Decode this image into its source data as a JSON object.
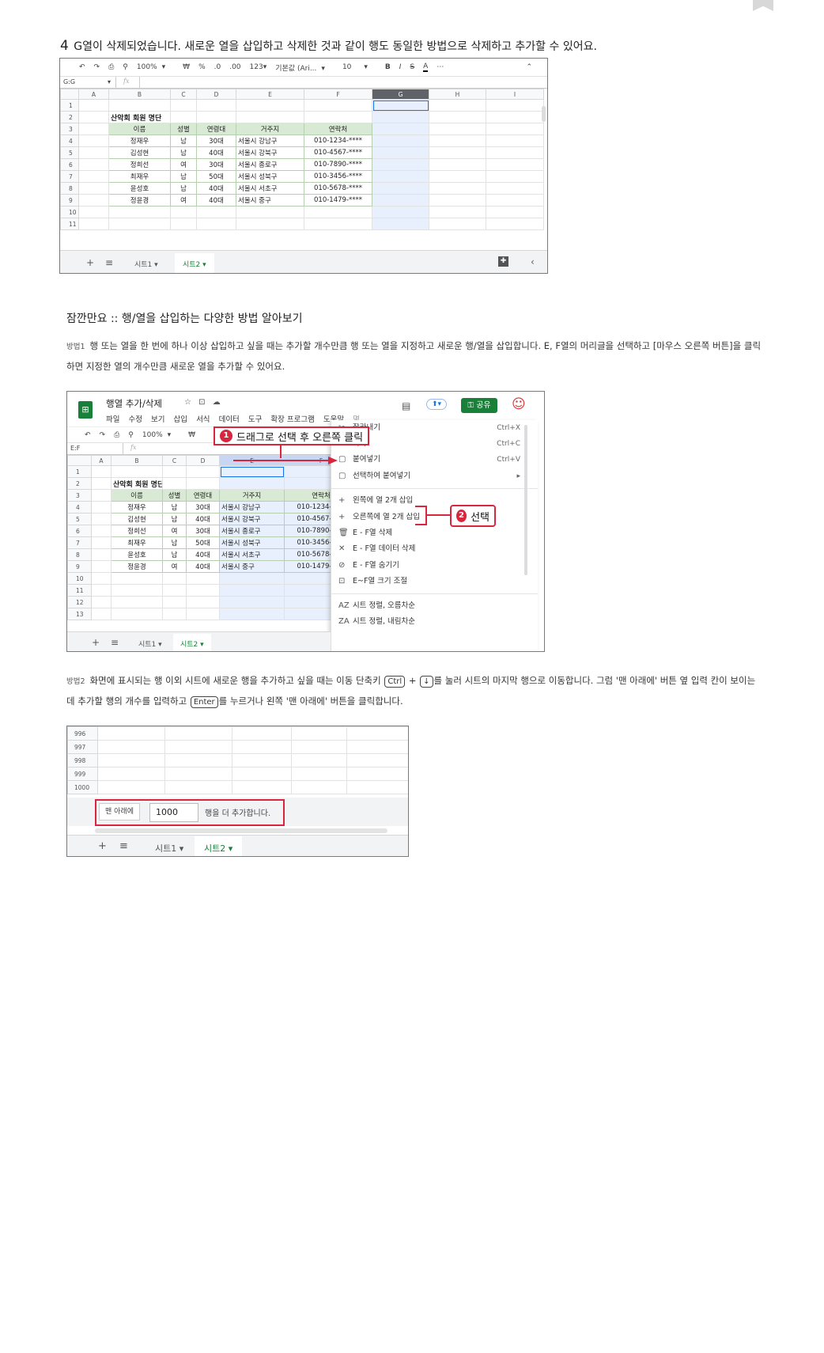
{
  "step4": {
    "number": "4",
    "text": "G열이 삭제되었습니다. 새로운 열을 삽입하고 삭제한 것과 같이 행도 동일한 방법으로 삭제하고 추가할 수 있어요."
  },
  "sheet1": {
    "toolbar": {
      "undo": "↶",
      "redo": "↷",
      "print": "⎙",
      "paint": "⚲",
      "zoom": "100%",
      "zoom_caret": "▾",
      "currency": "₩",
      "percent": "%",
      "dec_less": ".0",
      "dec_more": ".00",
      "format": "123▾",
      "font": "기본값 (Ari...",
      "font_caret": "▾",
      "size": "10",
      "size_caret": "▾",
      "bold": "B",
      "italic": "I",
      "strike": "S",
      "text_color": "A",
      "more": "⋯",
      "collapse": "⌃"
    },
    "namebox": "G:G",
    "namebox_caret": "▾",
    "fx": "fx",
    "columns": [
      "A",
      "B",
      "C",
      "D",
      "E",
      "F",
      "G",
      "H",
      "I"
    ],
    "row_numbers": [
      "1",
      "2",
      "3",
      "4",
      "5",
      "6",
      "7",
      "8",
      "9",
      "10",
      "11"
    ],
    "table_title": "산악회 회원 명단",
    "headers": [
      "이름",
      "성별",
      "연령대",
      "거주지",
      "연락처"
    ],
    "rows": [
      [
        "정재우",
        "남",
        "30대",
        "서울시 강남구",
        "010-1234-****"
      ],
      [
        "김성현",
        "남",
        "40대",
        "서울시 강북구",
        "010-4567-****"
      ],
      [
        "정희선",
        "여",
        "30대",
        "서울시 종로구",
        "010-7890-****"
      ],
      [
        "최재우",
        "남",
        "50대",
        "서울시 성북구",
        "010-3456-****"
      ],
      [
        "윤성호",
        "남",
        "40대",
        "서울시 서초구",
        "010-5678-****"
      ],
      [
        "정윤경",
        "여",
        "40대",
        "서울시 중구",
        "010-1479-****"
      ]
    ],
    "tabs": {
      "add": "+",
      "list": "≡",
      "sheet1": "시트1 ▾",
      "sheet2": "시트2 ▾",
      "explore": "✚",
      "nav": "‹"
    }
  },
  "tip": {
    "title": "잠깐만요 :: 행/열을 삽입하는 다양한 방법 알아보기",
    "method1_tag": "방법1",
    "method1_text": "행 또는 열을 한 번에 하나 이상 삽입하고 싶을 때는 추가할 개수만큼 행 또는 열을 지정하고 새로운 행/열을 삽입합니다. E, F열의 머리글을 선택하고 [마우스 오른쪽 버튼]을 클릭하면 지정한 열의 개수만큼 새로운 열을 추가할 수 있어요.",
    "method2_tag": "방법2",
    "method2_text_a": "화면에 표시되는 행 이외 시트에 새로운 행을 추가하고 싶을 때는 이동 단축키",
    "key_ctrl": "Ctrl",
    "plus": "+",
    "key_down": "↓",
    "method2_text_b": "를 눌러 시트의 마지막 행으로 이동합니다. 그럼 '맨 아래에' 버튼 옆 입력 칸이 보이는데 추가할 행의 개수를 입력하고",
    "key_enter": "Enter",
    "method2_text_c": "를 누르거나 왼쪽 '맨 아래에' 버튼을 클릭합니다."
  },
  "sheet2": {
    "doc_title": "행열 추가/삭제",
    "title_icons": [
      "☆",
      "⊡",
      "☁"
    ],
    "menu": [
      "파일",
      "수정",
      "보기",
      "삽입",
      "서식",
      "데이터",
      "도구",
      "확장 프로그램",
      "도움말",
      "몇..."
    ],
    "comment_icon": "▤",
    "present_icon": "⬆▾",
    "share": "공유",
    "avatar": "☺",
    "toolbar": {
      "undo": "↶",
      "redo": "↷",
      "print": "⎙",
      "paint": "⚲",
      "zoom": "100%",
      "zoom_caret": "▾",
      "currency": "₩",
      "collapse": "⌃"
    },
    "namebox": "E:F",
    "fx": "fx",
    "columns": [
      "A",
      "B",
      "C",
      "D",
      "E",
      "F"
    ],
    "row_numbers": [
      "1",
      "2",
      "3",
      "4",
      "5",
      "6",
      "7",
      "8",
      "9",
      "10",
      "11",
      "12",
      "13"
    ],
    "callout1_badge": "1",
    "callout1": "드래그로 선택 후 오른쪽 클릭",
    "callout2_badge": "2",
    "callout2": "선택",
    "context_menu": [
      {
        "icon": "✂",
        "label": "잘라내기",
        "shortcut": "Ctrl+X"
      },
      {
        "icon": "❐",
        "label": "복사",
        "shortcut": "Ctrl+C"
      },
      {
        "icon": "▢",
        "label": "붙여넣기",
        "shortcut": "Ctrl+V"
      },
      {
        "icon": "▢",
        "label": "선택하여 붙여넣기",
        "shortcut": "▸"
      },
      {
        "icon": "+",
        "label": "왼쪽에 열 2개 삽입",
        "shortcut": ""
      },
      {
        "icon": "+",
        "label": "오른쪽에 열 2개 삽입",
        "shortcut": ""
      },
      {
        "icon": "🗑",
        "label": "E - F열 삭제",
        "shortcut": ""
      },
      {
        "icon": "✕",
        "label": "E - F열 데이터 삭제",
        "shortcut": ""
      },
      {
        "icon": "⊘",
        "label": "E - F열 숨기기",
        "shortcut": ""
      },
      {
        "icon": "⊡",
        "label": "E~F열 크기 조절",
        "shortcut": ""
      },
      {
        "icon": "AZ",
        "label": "시트 정렬, 오름차순",
        "shortcut": ""
      },
      {
        "icon": "ZA",
        "label": "시트 정렬, 내림차순",
        "shortcut": ""
      }
    ],
    "tabs": {
      "add": "+",
      "list": "≡",
      "sheet1": "시트1 ▾",
      "sheet2": "시트2 ▾"
    }
  },
  "sheet3": {
    "row_numbers": [
      "996",
      "997",
      "998",
      "999",
      "1000"
    ],
    "add_button": "맨 아래에",
    "rows_value": "1000",
    "suffix": "행을 더 추가합니다.",
    "tabs": {
      "add": "+",
      "list": "≡",
      "sheet1": "시트1 ▾",
      "sheet2": "시트2 ▾"
    }
  },
  "colors": {
    "accent_red": "#d7263d",
    "sheets_green": "#188038",
    "header_green": "#d8ead3",
    "selection_blue": "#e8f0fd"
  }
}
